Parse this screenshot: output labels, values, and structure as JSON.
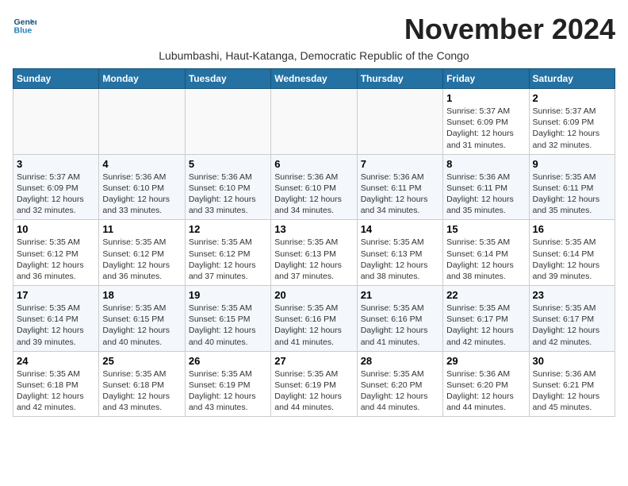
{
  "header": {
    "logo_line1": "General",
    "logo_line2": "Blue",
    "month": "November 2024",
    "subtitle": "Lubumbashi, Haut-Katanga, Democratic Republic of the Congo"
  },
  "weekdays": [
    "Sunday",
    "Monday",
    "Tuesday",
    "Wednesday",
    "Thursday",
    "Friday",
    "Saturday"
  ],
  "weeks": [
    [
      {
        "day": "",
        "info": ""
      },
      {
        "day": "",
        "info": ""
      },
      {
        "day": "",
        "info": ""
      },
      {
        "day": "",
        "info": ""
      },
      {
        "day": "",
        "info": ""
      },
      {
        "day": "1",
        "info": "Sunrise: 5:37 AM\nSunset: 6:09 PM\nDaylight: 12 hours and 31 minutes."
      },
      {
        "day": "2",
        "info": "Sunrise: 5:37 AM\nSunset: 6:09 PM\nDaylight: 12 hours and 32 minutes."
      }
    ],
    [
      {
        "day": "3",
        "info": "Sunrise: 5:37 AM\nSunset: 6:09 PM\nDaylight: 12 hours and 32 minutes."
      },
      {
        "day": "4",
        "info": "Sunrise: 5:36 AM\nSunset: 6:10 PM\nDaylight: 12 hours and 33 minutes."
      },
      {
        "day": "5",
        "info": "Sunrise: 5:36 AM\nSunset: 6:10 PM\nDaylight: 12 hours and 33 minutes."
      },
      {
        "day": "6",
        "info": "Sunrise: 5:36 AM\nSunset: 6:10 PM\nDaylight: 12 hours and 34 minutes."
      },
      {
        "day": "7",
        "info": "Sunrise: 5:36 AM\nSunset: 6:11 PM\nDaylight: 12 hours and 34 minutes."
      },
      {
        "day": "8",
        "info": "Sunrise: 5:36 AM\nSunset: 6:11 PM\nDaylight: 12 hours and 35 minutes."
      },
      {
        "day": "9",
        "info": "Sunrise: 5:35 AM\nSunset: 6:11 PM\nDaylight: 12 hours and 35 minutes."
      }
    ],
    [
      {
        "day": "10",
        "info": "Sunrise: 5:35 AM\nSunset: 6:12 PM\nDaylight: 12 hours and 36 minutes."
      },
      {
        "day": "11",
        "info": "Sunrise: 5:35 AM\nSunset: 6:12 PM\nDaylight: 12 hours and 36 minutes."
      },
      {
        "day": "12",
        "info": "Sunrise: 5:35 AM\nSunset: 6:12 PM\nDaylight: 12 hours and 37 minutes."
      },
      {
        "day": "13",
        "info": "Sunrise: 5:35 AM\nSunset: 6:13 PM\nDaylight: 12 hours and 37 minutes."
      },
      {
        "day": "14",
        "info": "Sunrise: 5:35 AM\nSunset: 6:13 PM\nDaylight: 12 hours and 38 minutes."
      },
      {
        "day": "15",
        "info": "Sunrise: 5:35 AM\nSunset: 6:14 PM\nDaylight: 12 hours and 38 minutes."
      },
      {
        "day": "16",
        "info": "Sunrise: 5:35 AM\nSunset: 6:14 PM\nDaylight: 12 hours and 39 minutes."
      }
    ],
    [
      {
        "day": "17",
        "info": "Sunrise: 5:35 AM\nSunset: 6:14 PM\nDaylight: 12 hours and 39 minutes."
      },
      {
        "day": "18",
        "info": "Sunrise: 5:35 AM\nSunset: 6:15 PM\nDaylight: 12 hours and 40 minutes."
      },
      {
        "day": "19",
        "info": "Sunrise: 5:35 AM\nSunset: 6:15 PM\nDaylight: 12 hours and 40 minutes."
      },
      {
        "day": "20",
        "info": "Sunrise: 5:35 AM\nSunset: 6:16 PM\nDaylight: 12 hours and 41 minutes."
      },
      {
        "day": "21",
        "info": "Sunrise: 5:35 AM\nSunset: 6:16 PM\nDaylight: 12 hours and 41 minutes."
      },
      {
        "day": "22",
        "info": "Sunrise: 5:35 AM\nSunset: 6:17 PM\nDaylight: 12 hours and 42 minutes."
      },
      {
        "day": "23",
        "info": "Sunrise: 5:35 AM\nSunset: 6:17 PM\nDaylight: 12 hours and 42 minutes."
      }
    ],
    [
      {
        "day": "24",
        "info": "Sunrise: 5:35 AM\nSunset: 6:18 PM\nDaylight: 12 hours and 42 minutes."
      },
      {
        "day": "25",
        "info": "Sunrise: 5:35 AM\nSunset: 6:18 PM\nDaylight: 12 hours and 43 minutes."
      },
      {
        "day": "26",
        "info": "Sunrise: 5:35 AM\nSunset: 6:19 PM\nDaylight: 12 hours and 43 minutes."
      },
      {
        "day": "27",
        "info": "Sunrise: 5:35 AM\nSunset: 6:19 PM\nDaylight: 12 hours and 44 minutes."
      },
      {
        "day": "28",
        "info": "Sunrise: 5:35 AM\nSunset: 6:20 PM\nDaylight: 12 hours and 44 minutes."
      },
      {
        "day": "29",
        "info": "Sunrise: 5:36 AM\nSunset: 6:20 PM\nDaylight: 12 hours and 44 minutes."
      },
      {
        "day": "30",
        "info": "Sunrise: 5:36 AM\nSunset: 6:21 PM\nDaylight: 12 hours and 45 minutes."
      }
    ]
  ]
}
